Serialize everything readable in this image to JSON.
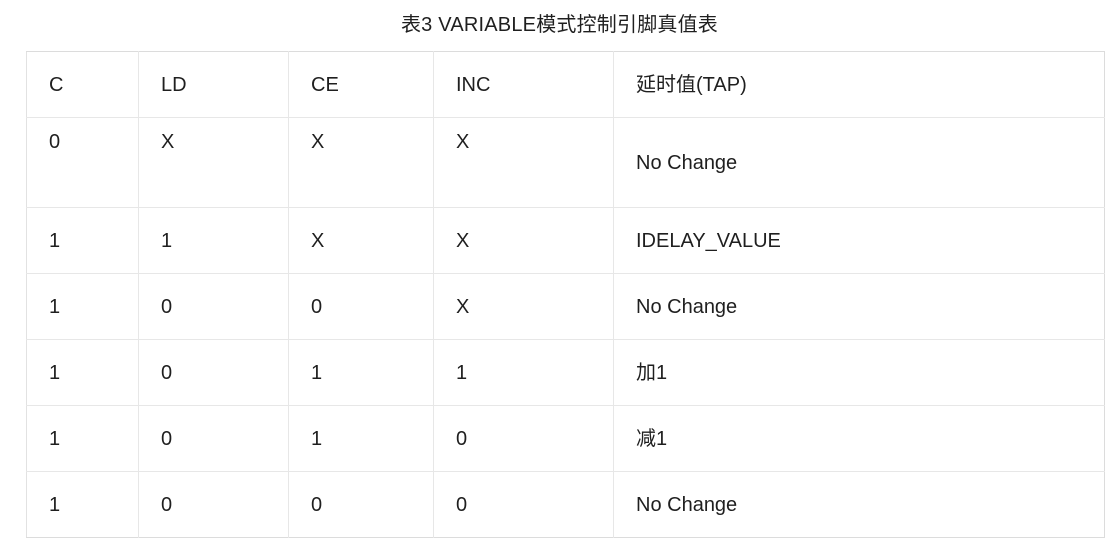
{
  "caption": "表3 VARIABLE模式控制引脚真值表",
  "colors": {
    "page_background": "#ffffff",
    "text": "#1f1f1f",
    "border": "#e7e7e7",
    "border_outer": "#dcdcdc"
  },
  "table": {
    "name": "variable-mode-control-pin-truth-table",
    "columns": [
      "C",
      "LD",
      "CE",
      "INC",
      "延时值(TAP)"
    ],
    "rows": [
      {
        "cells": [
          "0",
          "X",
          "X",
          "X",
          "No Change"
        ],
        "tall": true
      },
      {
        "cells": [
          "1",
          "1",
          "X",
          "X",
          "IDELAY_VALUE"
        ],
        "tall": false
      },
      {
        "cells": [
          "1",
          "0",
          "0",
          "X",
          "No Change"
        ],
        "tall": false
      },
      {
        "cells": [
          "1",
          "0",
          "1",
          "1",
          "加1"
        ],
        "tall": false
      },
      {
        "cells": [
          "1",
          "0",
          "1",
          "0",
          "减1"
        ],
        "tall": false
      },
      {
        "cells": [
          "1",
          "0",
          "0",
          "0",
          "No Change"
        ],
        "tall": false
      }
    ]
  }
}
